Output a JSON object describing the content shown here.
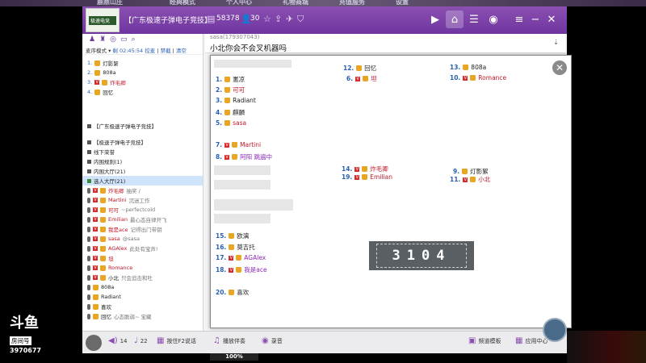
{
  "top_strip": {
    "items": [
      "鹿鼎山庄",
      "经典模式",
      "个人中心",
      "礼物商城",
      "充值服务",
      "设置"
    ]
  },
  "titlebar": {
    "logo_text": "极速电竞",
    "room_name": "【广东极速子弹电子竞技】",
    "room_id": "58378",
    "online_count": "30"
  },
  "left": {
    "mode_bar": {
      "mode": "麦序模式",
      "timer_label": "剩 02:45:54",
      "control": "控麦",
      "disable": "禁截",
      "clear": "清空"
    },
    "mic_queue": [
      {
        "index": "1.",
        "name": "灯影絮"
      },
      {
        "index": "2.",
        "name": "808a"
      },
      {
        "index": "3.",
        "name": "炸毛卿"
      },
      {
        "index": "4.",
        "name": "回忆"
      }
    ],
    "tree": [
      {
        "label": "【广东极速子弹电子竞技】"
      },
      {
        "label": "【极速子弹电子竞技】"
      },
      {
        "label": "线下荣誉"
      },
      {
        "label": "内围规则(1)"
      },
      {
        "label": "内围大厅(21)"
      }
    ],
    "hall_label": "选人大厅(21)",
    "users": [
      {
        "name": "炸毛卿",
        "note": "抽奖 /"
      },
      {
        "name": "Martini",
        "note": "沉迷工作"
      },
      {
        "name": "可可",
        "note": "~perfectcold"
      },
      {
        "name": "Emilian",
        "note": "最心态自律开飞"
      },
      {
        "name": "我是ace",
        "note": "记得出门带钥"
      },
      {
        "name": "sasa",
        "note": "@sasa"
      },
      {
        "name": "AGAlex",
        "note": "此处有宝声!"
      },
      {
        "name": "坦",
        "note": ""
      },
      {
        "name": "Romance",
        "note": ""
      },
      {
        "name": "小北",
        "note": "只会追击和吐"
      },
      {
        "name": "808a",
        "note": ""
      },
      {
        "name": "Radiant",
        "note": ""
      },
      {
        "name": "喜欢",
        "note": ""
      },
      {
        "name": "回忆",
        "note": "心态脆弱~ 宝藏"
      }
    ]
  },
  "chat": {
    "who": "sasa(179307043)",
    "message": "小北你会不会叉机器吗"
  },
  "overlay": {
    "timer": "3104",
    "seats_left": [
      {
        "num": "1.",
        "name": "憲凉"
      },
      {
        "num": "2.",
        "name": "可可"
      },
      {
        "num": "3.",
        "name": "Radiant"
      },
      {
        "num": "4.",
        "name": "麒麟"
      },
      {
        "num": "5.",
        "name": "sasa"
      },
      {
        "num": "7.",
        "name": "Martini"
      },
      {
        "num": "8.",
        "name": "阿阳 跳遍中"
      },
      {
        "num": "15.",
        "name": "欧漓"
      },
      {
        "num": "16.",
        "name": "莫吉托"
      },
      {
        "num": "17.",
        "name": "AGAlex"
      },
      {
        "num": "18.",
        "name": "我是ace"
      },
      {
        "num": "20.",
        "name": "喜欢"
      }
    ],
    "seats_mid": [
      {
        "num": "12.",
        "name": "回忆"
      },
      {
        "num": "6.",
        "name": "坦"
      },
      {
        "num": "14.",
        "name": "炸毛卿"
      },
      {
        "num": "19.",
        "name": "Emilian"
      }
    ],
    "seats_right": [
      {
        "num": "13.",
        "name": "808a"
      },
      {
        "num": "10.",
        "name": "Romance"
      },
      {
        "num": "9.",
        "name": "灯影絮"
      },
      {
        "num": "11.",
        "name": "小北"
      }
    ]
  },
  "bottom": {
    "volume_in": "14",
    "volume_out": "22",
    "percent": "100%",
    "ptt_label": "按住F2说话",
    "music_label": "播放伴奏",
    "record_label": "录音",
    "channel_template": "频道模板",
    "app_center": "应用中心"
  },
  "watermark": {
    "brand": "斗鱼",
    "room_label": "房间号",
    "room_number": "3970677"
  }
}
